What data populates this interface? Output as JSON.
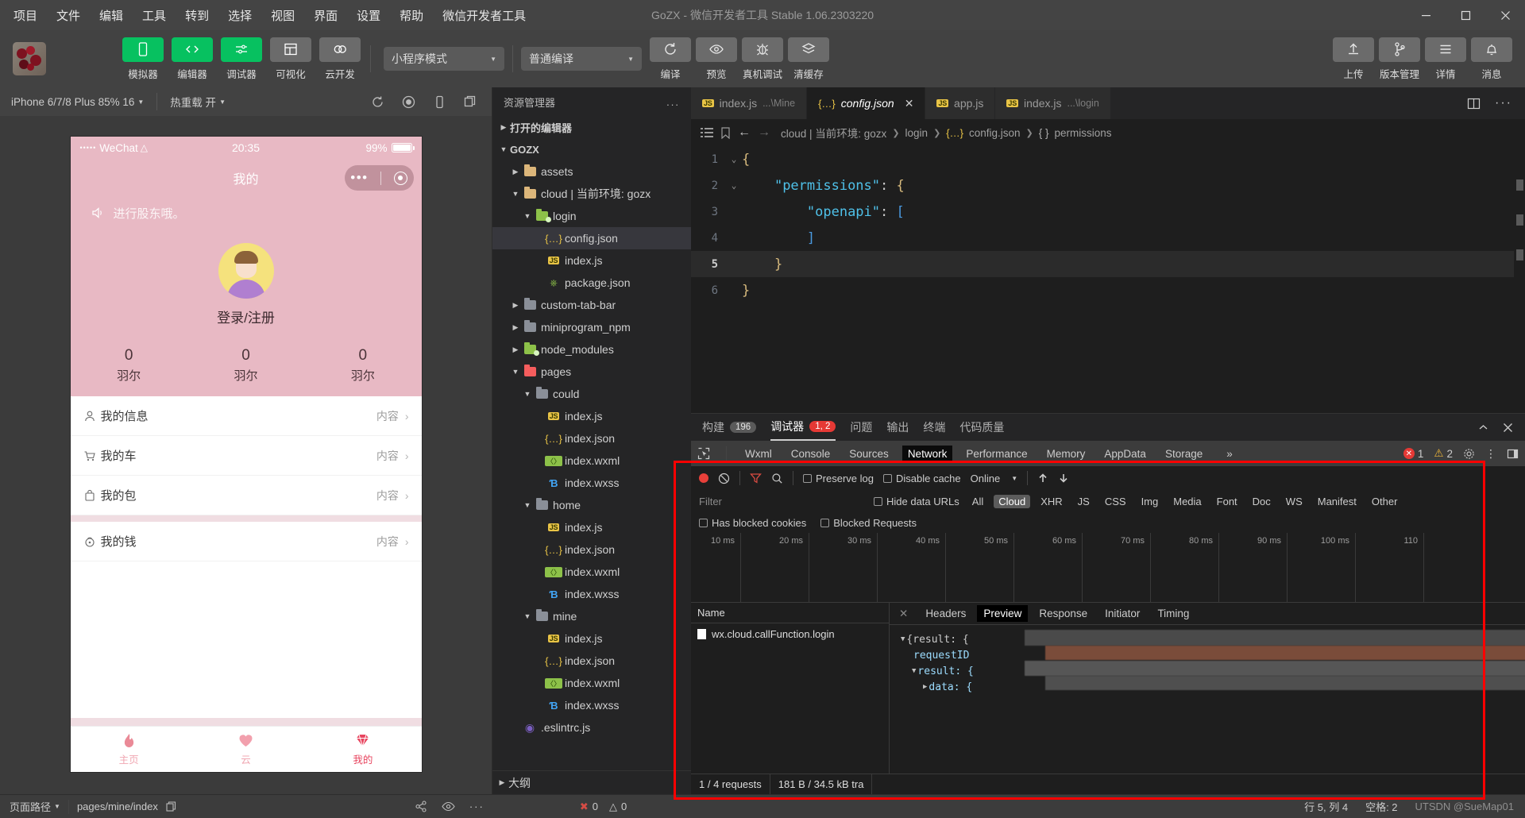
{
  "titlebar": {
    "menus": [
      "项目",
      "文件",
      "编辑",
      "工具",
      "转到",
      "选择",
      "视图",
      "界面",
      "设置",
      "帮助",
      "微信开发者工具"
    ],
    "window_title": "GoZX - 微信开发者工具 Stable 1.06.2303220",
    "minimize": "—",
    "maximize": "▢",
    "close": "✕"
  },
  "toolbar": {
    "buttons": [
      {
        "label": "模拟器",
        "icon": "phone-icon",
        "color": "green"
      },
      {
        "label": "编辑器",
        "icon": "code-icon",
        "color": "green"
      },
      {
        "label": "调试器",
        "icon": "sliders-icon",
        "color": "green"
      },
      {
        "label": "可视化",
        "icon": "layout-icon",
        "color": "gray"
      },
      {
        "label": "云开发",
        "icon": "cloud-icon",
        "color": "gray"
      }
    ],
    "mode_select": "小程序模式",
    "compile_select": "普通编译",
    "actions": [
      {
        "label": "编译",
        "icon": "refresh-icon"
      },
      {
        "label": "预览",
        "icon": "eye-icon"
      },
      {
        "label": "真机调试",
        "icon": "bug-icon"
      },
      {
        "label": "清缓存",
        "icon": "layers-icon"
      }
    ],
    "right_actions": [
      {
        "label": "上传",
        "icon": "upload-icon"
      },
      {
        "label": "版本管理",
        "icon": "branch-icon"
      },
      {
        "label": "详情",
        "icon": "menu-icon"
      },
      {
        "label": "消息",
        "icon": "bell-icon"
      }
    ]
  },
  "simulator": {
    "device": "iPhone 6/7/8 Plus 85% 16",
    "hot_reload": "热重载 开",
    "icons": [
      "refresh-icon",
      "record-icon",
      "rotate-icon",
      "copy-icon"
    ],
    "status": {
      "carrier": "WeChat",
      "dots": "•••••",
      "wifi": "⌃",
      "time": "20:35",
      "battery": "99%"
    },
    "nav_title": "我的",
    "notice": "进行股东哦。",
    "login_label": "登录/注册",
    "stats": [
      {
        "num": "0",
        "label": "羽尔"
      },
      {
        "num": "0",
        "label": "羽尔"
      },
      {
        "num": "0",
        "label": "羽尔"
      }
    ],
    "rows": [
      {
        "icon": "person-icon",
        "label": "我的信息",
        "value": "内容"
      },
      {
        "icon": "cart-icon",
        "label": "我的车",
        "value": "内容"
      },
      {
        "icon": "bag-icon",
        "label": "我的包",
        "value": "内容"
      },
      {
        "icon": "lock-icon",
        "label": "我的钱",
        "value": "内容"
      }
    ],
    "tabbar": [
      {
        "icon": "flame-icon",
        "label": "主页",
        "glyph": "🔥"
      },
      {
        "icon": "heart-icon",
        "label": "云",
        "glyph": "♥"
      },
      {
        "icon": "diamond-icon",
        "label": "我的",
        "glyph": "◈"
      }
    ]
  },
  "explorer": {
    "title": "资源管理器",
    "more": "...",
    "open_editors": "打开的编辑器",
    "project": "GOZX",
    "outline": "大纲",
    "tree": [
      {
        "label": "assets",
        "type": "folder",
        "depth": 1,
        "open": false,
        "color": "f-yellow"
      },
      {
        "label": "cloud | 当前环境: gozx",
        "type": "folder",
        "depth": 1,
        "open": true,
        "color": "f-yellow"
      },
      {
        "label": "login",
        "type": "folder",
        "depth": 2,
        "open": true,
        "color": "f-green"
      },
      {
        "label": "config.json",
        "type": "json",
        "depth": 3,
        "selected": true
      },
      {
        "label": "index.js",
        "type": "js",
        "depth": 3
      },
      {
        "label": "package.json",
        "type": "node",
        "depth": 3
      },
      {
        "label": "custom-tab-bar",
        "type": "folder",
        "depth": 1,
        "open": false,
        "color": "f-gray"
      },
      {
        "label": "miniprogram_npm",
        "type": "folder",
        "depth": 1,
        "open": false,
        "color": "f-gray"
      },
      {
        "label": "node_modules",
        "type": "folder",
        "depth": 1,
        "open": false,
        "color": "f-green"
      },
      {
        "label": "pages",
        "type": "folder",
        "depth": 1,
        "open": true,
        "color": "f-red"
      },
      {
        "label": "could",
        "type": "folder",
        "depth": 2,
        "open": true,
        "color": "f-gray"
      },
      {
        "label": "index.js",
        "type": "js",
        "depth": 3
      },
      {
        "label": "index.json",
        "type": "json",
        "depth": 3
      },
      {
        "label": "index.wxml",
        "type": "wxml",
        "depth": 3
      },
      {
        "label": "index.wxss",
        "type": "wxss",
        "depth": 3
      },
      {
        "label": "home",
        "type": "folder",
        "depth": 2,
        "open": true,
        "color": "f-gray"
      },
      {
        "label": "index.js",
        "type": "js",
        "depth": 3
      },
      {
        "label": "index.json",
        "type": "json",
        "depth": 3
      },
      {
        "label": "index.wxml",
        "type": "wxml",
        "depth": 3
      },
      {
        "label": "index.wxss",
        "type": "wxss",
        "depth": 3
      },
      {
        "label": "mine",
        "type": "folder",
        "depth": 2,
        "open": true,
        "color": "f-gray"
      },
      {
        "label": "index.js",
        "type": "js",
        "depth": 3
      },
      {
        "label": "index.json",
        "type": "json",
        "depth": 3
      },
      {
        "label": "index.wxml",
        "type": "wxml",
        "depth": 3
      },
      {
        "label": "index.wxss",
        "type": "wxss",
        "depth": 3
      },
      {
        "label": ".eslintrc.js",
        "type": "eslint",
        "depth": 1
      }
    ]
  },
  "editor": {
    "tabs": [
      {
        "name": "index.js",
        "sub": "...\\Mine",
        "icon": "js",
        "active": false
      },
      {
        "name": "config.json",
        "sub": "",
        "icon": "json",
        "active": true,
        "close": "✕"
      },
      {
        "name": "app.js",
        "sub": "",
        "icon": "js",
        "active": false
      },
      {
        "name": "index.js",
        "sub": "...\\login",
        "icon": "js",
        "active": false
      }
    ],
    "breadcrumb": [
      "cloud | 当前环境: gozx",
      "login",
      "config.json",
      "permissions"
    ],
    "code_lines": [
      {
        "num": "1",
        "fold": "⌄",
        "text": "{",
        "cur": false
      },
      {
        "num": "2",
        "fold": "⌄",
        "text": "    \"permissions\": {",
        "cur": false
      },
      {
        "num": "3",
        "fold": "",
        "text": "        \"openapi\": [",
        "cur": false
      },
      {
        "num": "4",
        "fold": "",
        "text": "        ]",
        "cur": false
      },
      {
        "num": "5",
        "fold": "",
        "text": "    }",
        "cur": true
      },
      {
        "num": "6",
        "fold": "",
        "text": "}",
        "cur": false
      }
    ]
  },
  "devtools": {
    "tabs": [
      {
        "label": "构建",
        "badge": "196",
        "badge_color": "gray",
        "active": false
      },
      {
        "label": "调试器",
        "badge": "1, 2",
        "badge_color": "red",
        "active": true
      },
      {
        "label": "问题",
        "badge": "",
        "active": false
      },
      {
        "label": "输出",
        "badge": "",
        "active": false
      },
      {
        "label": "终端",
        "badge": "",
        "active": false
      },
      {
        "label": "代码质量",
        "badge": "",
        "active": false
      }
    ],
    "panel_tabs": [
      "Wxml",
      "Console",
      "Sources",
      "Network",
      "Performance",
      "Memory",
      "AppData",
      "Storage"
    ],
    "panel_active": "Network",
    "panel_overflow": "»",
    "error_count": "1",
    "warn_count": "2",
    "network": {
      "preserve_log": "Preserve log",
      "disable_cache": "Disable cache",
      "throttle": "Online",
      "filter_placeholder": "Filter",
      "hide_data_urls": "Hide data URLs",
      "types": [
        "All",
        "Cloud",
        "XHR",
        "JS",
        "CSS",
        "Img",
        "Media",
        "Font",
        "Doc",
        "WS",
        "Manifest",
        "Other"
      ],
      "type_active": "Cloud",
      "has_blocked_cookies": "Has blocked cookies",
      "blocked_requests": "Blocked Requests",
      "timeline_ticks": [
        "10 ms",
        "20 ms",
        "30 ms",
        "40 ms",
        "50 ms",
        "60 ms",
        "70 ms",
        "80 ms",
        "90 ms",
        "100 ms",
        "110"
      ],
      "name_header": "Name",
      "requests": [
        "wx.cloud.callFunction.login"
      ],
      "detail_tabs": [
        "Headers",
        "Preview",
        "Response",
        "Initiator",
        "Timing"
      ],
      "detail_active": "Preview",
      "preview_lines": [
        {
          "tri": "▼",
          "text": "{result: {",
          "indent": 0
        },
        {
          "tri": "",
          "text": "requestID",
          "indent": 1,
          "key": true
        },
        {
          "tri": "▼",
          "text": "result: {",
          "indent": 1,
          "key": true
        },
        {
          "tri": "▶",
          "text": "data: {",
          "indent": 2,
          "key": true
        }
      ],
      "footer": [
        "1 / 4 requests",
        "181 B / 34.5 kB tra"
      ]
    }
  },
  "statusbar": {
    "page_path_label": "页面路径",
    "page_path": "pages/mine/index",
    "copy_icon": "copy-icon",
    "problems_errors": "0",
    "problems_warnings": "0",
    "line_col": "行 5, 列 4",
    "spaces": "空格: 2",
    "watermark": "UTSDN @SueMap01"
  }
}
